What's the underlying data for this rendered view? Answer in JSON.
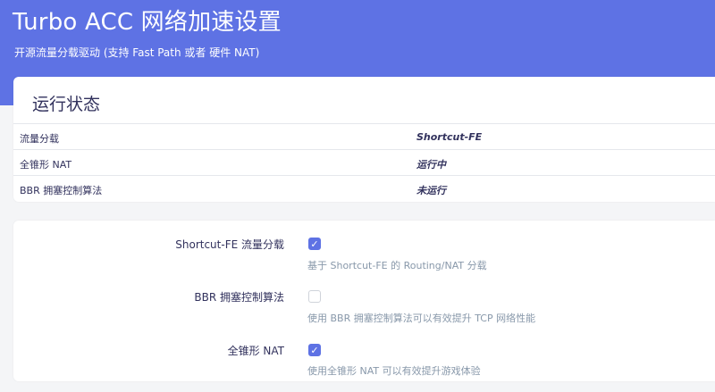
{
  "header": {
    "title": "Turbo ACC 网络加速设置",
    "description": "开源流量分载驱动 (支持 Fast Path 或者 硬件 NAT)"
  },
  "status": {
    "heading": "运行状态",
    "rows": [
      {
        "label": "流量分载",
        "value": "Shortcut-FE"
      },
      {
        "label": "全锥形 NAT",
        "value": "运行中"
      },
      {
        "label": "BBR 拥塞控制算法",
        "value": "未运行"
      }
    ]
  },
  "settings": {
    "options": [
      {
        "label": "Shortcut-FE 流量分载",
        "checked": true,
        "description": "基于 Shortcut-FE 的 Routing/NAT 分载"
      },
      {
        "label": "BBR 拥塞控制算法",
        "checked": false,
        "description": "使用 BBR 拥塞控制算法可以有效提升 TCP 网络性能"
      },
      {
        "label": "全锥形 NAT",
        "checked": true,
        "description": "使用全锥形 NAT 可以有效提升游戏体验"
      }
    ]
  },
  "icons": {
    "checkbox_checked": "check-icon"
  },
  "colors": {
    "accent": "#5e72e4",
    "muted_text": "#8898aa"
  }
}
